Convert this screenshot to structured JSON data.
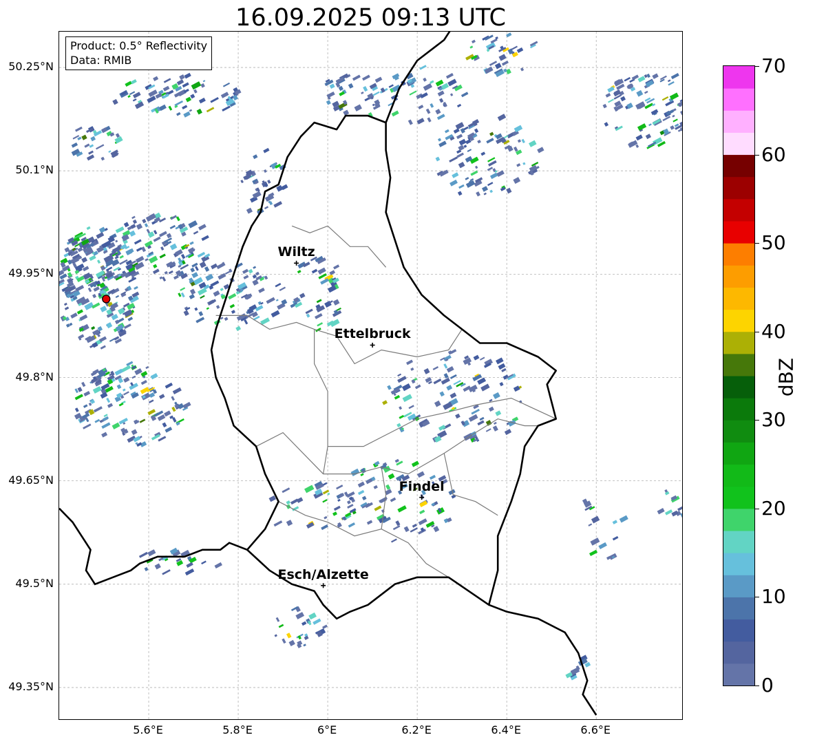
{
  "title": "16.09.2025 09:13 UTC",
  "info_box": {
    "product": "Product: 0.5° Reflectivity",
    "data": "Data: RMIB"
  },
  "cities": [
    {
      "name": "Wiltz",
      "lon": 5.93,
      "lat": 49.966
    },
    {
      "name": "Ettelbruck",
      "lon": 6.1,
      "lat": 49.847
    },
    {
      "name": "Findel",
      "lon": 6.21,
      "lat": 49.626
    },
    {
      "name": "Esch/Alzette",
      "lon": 5.99,
      "lat": 49.498
    }
  ],
  "radar_site": {
    "lon": 5.505,
    "lat": 49.914,
    "color": "#e00000"
  },
  "lat_ticks": [
    {
      "value": 50.25,
      "label": "50.25°N"
    },
    {
      "value": 50.1,
      "label": "50.1°N"
    },
    {
      "value": 49.95,
      "label": "49.95°N"
    },
    {
      "value": 49.8,
      "label": "49.8°N"
    },
    {
      "value": 49.65,
      "label": "49.65°N"
    },
    {
      "value": 49.5,
      "label": "49.5°N"
    },
    {
      "value": 49.35,
      "label": "49.35°N"
    }
  ],
  "lon_ticks": [
    {
      "value": 5.6,
      "label": "5.6°E"
    },
    {
      "value": 5.8,
      "label": "5.8°E"
    },
    {
      "value": 6.0,
      "label": "6°E"
    },
    {
      "value": 6.2,
      "label": "6.2°E"
    },
    {
      "value": 6.4,
      "label": "6.4°E"
    },
    {
      "value": 6.6,
      "label": "6.6°E"
    }
  ],
  "extent": {
    "lon_min": 5.4,
    "lon_max": 6.795,
    "lat_min": 49.302,
    "lat_max": 50.302
  },
  "colorbar": {
    "unit": "dBZ",
    "min": 0,
    "max": 70,
    "tick_labels": [
      "0",
      "10",
      "20",
      "30",
      "40",
      "50",
      "60",
      "70"
    ],
    "colors": [
      "#6474a8",
      "#54659f",
      "#435c9f",
      "#4c74aa",
      "#5a9ac6",
      "#66c0dc",
      "#62d4c4",
      "#3fd46b",
      "#11c21c",
      "#12ba18",
      "#10a612",
      "#108c10",
      "#0b7a0b",
      "#065f0a",
      "#46780a",
      "#acb005",
      "#fdd400",
      "#fdb800",
      "#fd9d00",
      "#fd7e00",
      "#e80000",
      "#c40000",
      "#9c0000",
      "#760000",
      "#ffdcff",
      "#ffb0ff",
      "#ff70ff",
      "#ee36ee"
    ]
  },
  "echo_clusters": [
    {
      "lon": 5.48,
      "lat": 49.93,
      "rx": 0.09,
      "ry": 0.09,
      "n": 180
    },
    {
      "lon": 5.45,
      "lat": 49.96,
      "rx": 0.06,
      "ry": 0.05,
      "n": 70
    },
    {
      "lon": 5.62,
      "lat": 49.99,
      "rx": 0.11,
      "ry": 0.05,
      "n": 110
    },
    {
      "lon": 5.78,
      "lat": 49.92,
      "rx": 0.12,
      "ry": 0.05,
      "n": 90
    },
    {
      "lon": 5.55,
      "lat": 49.76,
      "rx": 0.13,
      "ry": 0.06,
      "n": 130
    },
    {
      "lon": 5.66,
      "lat": 50.21,
      "rx": 0.15,
      "ry": 0.03,
      "n": 70
    },
    {
      "lon": 5.48,
      "lat": 50.14,
      "rx": 0.06,
      "ry": 0.03,
      "n": 30
    },
    {
      "lon": 5.85,
      "lat": 50.08,
      "rx": 0.05,
      "ry": 0.05,
      "n": 35
    },
    {
      "lon": 5.97,
      "lat": 49.92,
      "rx": 0.06,
      "ry": 0.06,
      "n": 40
    },
    {
      "lon": 6.06,
      "lat": 50.21,
      "rx": 0.09,
      "ry": 0.03,
      "n": 40
    },
    {
      "lon": 6.21,
      "lat": 50.21,
      "rx": 0.1,
      "ry": 0.04,
      "n": 45
    },
    {
      "lon": 6.35,
      "lat": 50.12,
      "rx": 0.12,
      "ry": 0.06,
      "n": 90
    },
    {
      "lon": 6.38,
      "lat": 50.27,
      "rx": 0.08,
      "ry": 0.03,
      "n": 35
    },
    {
      "lon": 6.71,
      "lat": 50.19,
      "rx": 0.1,
      "ry": 0.06,
      "n": 90
    },
    {
      "lon": 6.28,
      "lat": 49.77,
      "rx": 0.16,
      "ry": 0.07,
      "n": 110
    },
    {
      "lon": 6.14,
      "lat": 49.62,
      "rx": 0.14,
      "ry": 0.06,
      "n": 80
    },
    {
      "lon": 5.96,
      "lat": 49.61,
      "rx": 0.1,
      "ry": 0.04,
      "n": 35
    },
    {
      "lon": 5.93,
      "lat": 49.44,
      "rx": 0.06,
      "ry": 0.03,
      "n": 25
    },
    {
      "lon": 5.65,
      "lat": 49.53,
      "rx": 0.1,
      "ry": 0.02,
      "n": 20
    },
    {
      "lon": 6.6,
      "lat": 49.58,
      "rx": 0.08,
      "ry": 0.05,
      "n": 15
    },
    {
      "lon": 6.76,
      "lat": 49.61,
      "rx": 0.03,
      "ry": 0.03,
      "n": 10
    },
    {
      "lon": 6.55,
      "lat": 49.38,
      "rx": 0.03,
      "ry": 0.02,
      "n": 8
    }
  ],
  "borders": {
    "luxembourg": [
      [
        6.13,
        50.17
      ],
      [
        6.09,
        50.18
      ],
      [
        6.04,
        50.18
      ],
      [
        6.02,
        50.16
      ],
      [
        5.97,
        50.17
      ],
      [
        5.94,
        50.15
      ],
      [
        5.91,
        50.12
      ],
      [
        5.89,
        50.08
      ],
      [
        5.86,
        50.07
      ],
      [
        5.85,
        50.04
      ],
      [
        5.83,
        50.02
      ],
      [
        5.81,
        49.99
      ],
      [
        5.79,
        49.95
      ],
      [
        5.77,
        49.91
      ],
      [
        5.75,
        49.87
      ],
      [
        5.74,
        49.84
      ],
      [
        5.75,
        49.8
      ],
      [
        5.77,
        49.77
      ],
      [
        5.79,
        49.73
      ],
      [
        5.84,
        49.7
      ],
      [
        5.86,
        49.66
      ],
      [
        5.89,
        49.62
      ],
      [
        5.86,
        49.58
      ],
      [
        5.82,
        49.55
      ],
      [
        5.87,
        49.52
      ],
      [
        5.92,
        49.5
      ],
      [
        5.97,
        49.49
      ],
      [
        5.99,
        49.47
      ],
      [
        6.02,
        49.45
      ],
      [
        6.05,
        49.46
      ],
      [
        6.09,
        49.47
      ],
      [
        6.11,
        49.48
      ],
      [
        6.15,
        49.5
      ],
      [
        6.2,
        49.51
      ],
      [
        6.27,
        49.51
      ],
      [
        6.36,
        49.47
      ],
      [
        6.38,
        49.52
      ],
      [
        6.38,
        49.57
      ],
      [
        6.41,
        49.62
      ],
      [
        6.43,
        49.66
      ],
      [
        6.44,
        49.7
      ],
      [
        6.47,
        49.73
      ],
      [
        6.51,
        49.74
      ],
      [
        6.49,
        49.79
      ],
      [
        6.51,
        49.81
      ],
      [
        6.47,
        49.83
      ],
      [
        6.4,
        49.85
      ],
      [
        6.34,
        49.85
      ],
      [
        6.3,
        49.87
      ],
      [
        6.26,
        49.89
      ],
      [
        6.21,
        49.92
      ],
      [
        6.17,
        49.96
      ],
      [
        6.15,
        50.0
      ],
      [
        6.13,
        50.04
      ],
      [
        6.14,
        50.09
      ],
      [
        6.13,
        50.13
      ],
      [
        6.13,
        50.17
      ]
    ],
    "belgium_germany": [
      [
        6.13,
        50.17
      ],
      [
        6.16,
        50.22
      ],
      [
        6.2,
        50.26
      ],
      [
        6.26,
        50.29
      ],
      [
        6.28,
        50.31
      ]
    ],
    "france_belgium": [
      [
        5.4,
        49.61
      ],
      [
        5.43,
        49.59
      ],
      [
        5.47,
        49.55
      ],
      [
        5.46,
        49.52
      ],
      [
        5.48,
        49.5
      ],
      [
        5.52,
        49.51
      ],
      [
        5.56,
        49.52
      ],
      [
        5.58,
        49.53
      ],
      [
        5.62,
        49.54
      ],
      [
        5.68,
        49.54
      ],
      [
        5.72,
        49.55
      ],
      [
        5.76,
        49.55
      ],
      [
        5.78,
        49.56
      ],
      [
        5.82,
        49.55
      ]
    ],
    "germany_france": [
      [
        6.36,
        49.47
      ],
      [
        6.4,
        49.46
      ],
      [
        6.47,
        49.45
      ],
      [
        6.53,
        49.43
      ],
      [
        6.56,
        49.4
      ],
      [
        6.58,
        49.36
      ],
      [
        6.57,
        49.34
      ],
      [
        6.6,
        49.31
      ]
    ],
    "cantons": [
      [
        [
          5.92,
          50.02
        ],
        [
          5.96,
          50.01
        ],
        [
          6.0,
          50.02
        ],
        [
          6.05,
          49.99
        ],
        [
          6.09,
          49.99
        ],
        [
          6.13,
          49.96
        ]
      ],
      [
        [
          5.75,
          49.89
        ],
        [
          5.82,
          49.89
        ],
        [
          5.87,
          49.87
        ],
        [
          5.93,
          49.88
        ],
        [
          5.97,
          49.87
        ]
      ],
      [
        [
          5.97,
          49.87
        ],
        [
          6.02,
          49.86
        ],
        [
          6.06,
          49.82
        ],
        [
          6.12,
          49.84
        ],
        [
          6.2,
          49.83
        ],
        [
          6.27,
          49.84
        ],
        [
          6.3,
          49.87
        ]
      ],
      [
        [
          5.97,
          49.87
        ],
        [
          5.97,
          49.82
        ],
        [
          6.0,
          49.78
        ],
        [
          6.0,
          49.7
        ],
        [
          5.99,
          49.66
        ]
      ],
      [
        [
          5.84,
          49.7
        ],
        [
          5.9,
          49.72
        ],
        [
          5.99,
          49.66
        ],
        [
          6.06,
          49.66
        ],
        [
          6.12,
          49.67
        ],
        [
          6.18,
          49.66
        ],
        [
          6.26,
          49.69
        ],
        [
          6.33,
          49.72
        ],
        [
          6.38,
          49.74
        ],
        [
          6.44,
          49.73
        ],
        [
          6.47,
          49.73
        ]
      ],
      [
        [
          6.0,
          49.7
        ],
        [
          6.08,
          49.7
        ],
        [
          6.14,
          49.72
        ],
        [
          6.2,
          49.74
        ],
        [
          6.27,
          49.75
        ],
        [
          6.33,
          49.76
        ],
        [
          6.41,
          49.77
        ],
        [
          6.51,
          49.74
        ]
      ],
      [
        [
          5.89,
          49.62
        ],
        [
          5.95,
          49.6
        ],
        [
          6.0,
          49.59
        ],
        [
          6.06,
          49.57
        ],
        [
          6.12,
          49.58
        ],
        [
          6.18,
          49.56
        ],
        [
          6.22,
          49.53
        ],
        [
          6.27,
          49.51
        ]
      ],
      [
        [
          6.12,
          49.67
        ],
        [
          6.13,
          49.63
        ],
        [
          6.12,
          49.58
        ]
      ],
      [
        [
          6.26,
          49.69
        ],
        [
          6.28,
          49.63
        ],
        [
          6.33,
          49.62
        ],
        [
          6.38,
          49.6
        ]
      ]
    ]
  }
}
